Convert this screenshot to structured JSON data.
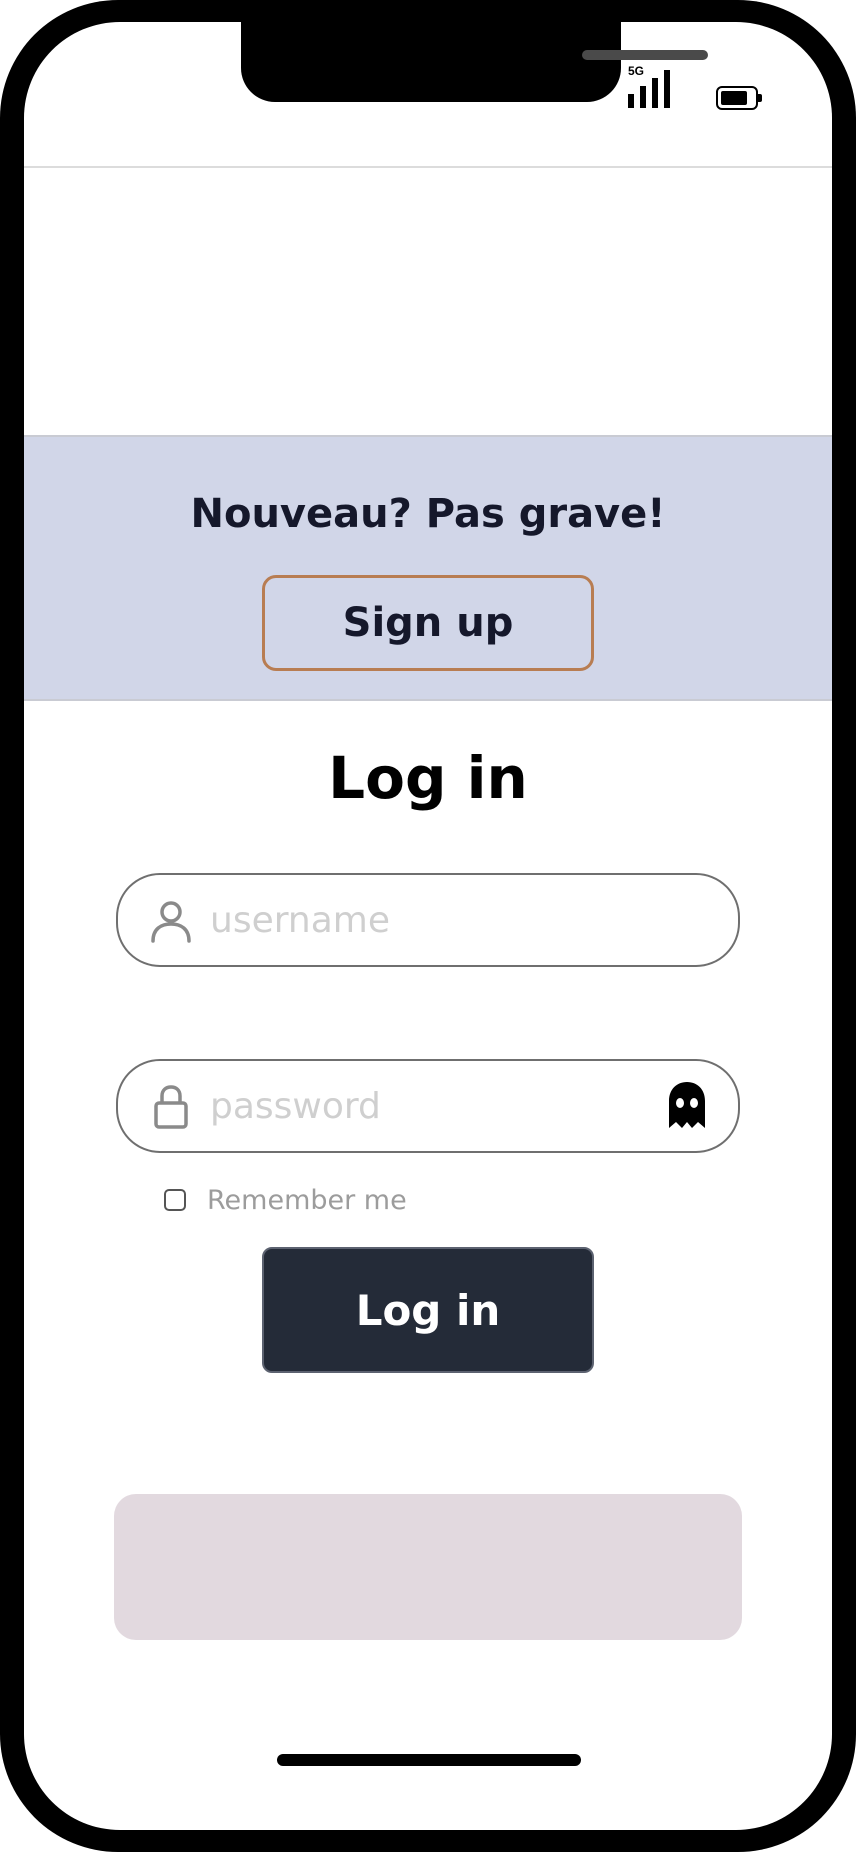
{
  "status_bar": {
    "network": "5G",
    "signal_icon": "cellular-signal-icon",
    "battery_icon": "battery-icon",
    "battery_level": 0.8
  },
  "banner": {
    "text": "Nouveau? Pas grave!",
    "signup_label": "Sign up",
    "background": "#d1d6e8",
    "button_border": "#b87d52"
  },
  "login": {
    "title": "Log in",
    "username": {
      "value": "",
      "placeholder": "username",
      "icon": "user-icon"
    },
    "password": {
      "value": "",
      "placeholder": "password",
      "icon": "lock-icon",
      "toggle_icon": "ghost-icon"
    },
    "remember_label": "Remember me",
    "remember_checked": false,
    "button_label": "Log in",
    "button_color": "#242b38"
  },
  "info_box": {
    "background": "#e2d9df"
  }
}
